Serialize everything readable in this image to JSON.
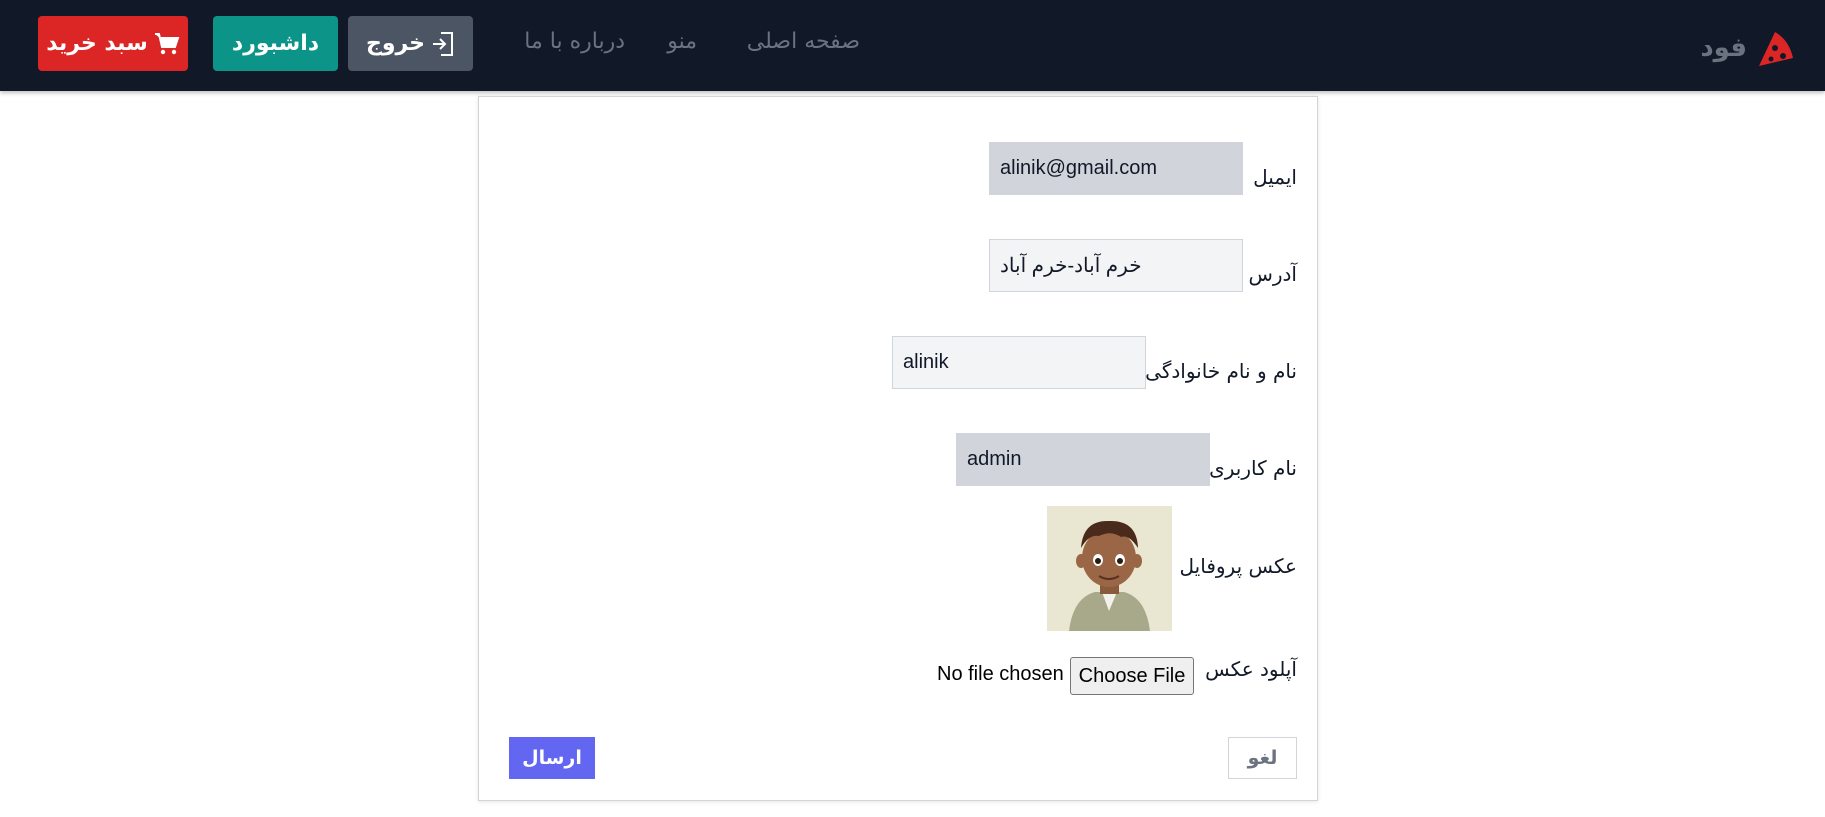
{
  "nav": {
    "brand": "فود",
    "links": [
      "صفحه اصلی",
      "منو",
      "درباره با ما"
    ],
    "logout_label": "خروج",
    "dashboard_label": "داشبورد",
    "cart_label": "سبد خرید"
  },
  "form": {
    "email": {
      "label": "ایمیل",
      "value": "alinik@gmail.com"
    },
    "address": {
      "label": "آدرس",
      "value": "خرم آباد-خرم آباد"
    },
    "fullname": {
      "label": "نام و نام خانوادگی",
      "value": "alinik"
    },
    "username": {
      "label": "نام کاربری",
      "value": "admin"
    },
    "avatar_label": "عکس پروفایل",
    "upload_label": "آپلود عکس",
    "choose_file": "Choose File",
    "no_file": "No file chosen",
    "cancel": "لغو",
    "submit": "ارسال"
  },
  "colors": {
    "navbar": "#111827",
    "cart": "#dc2626",
    "dashboard": "#0d9488",
    "logout": "#4b5563",
    "submit": "#6366f1",
    "brand_icon": "#dc2626"
  },
  "icons": [
    "pizza-icon",
    "logout-icon",
    "cart-icon"
  ]
}
